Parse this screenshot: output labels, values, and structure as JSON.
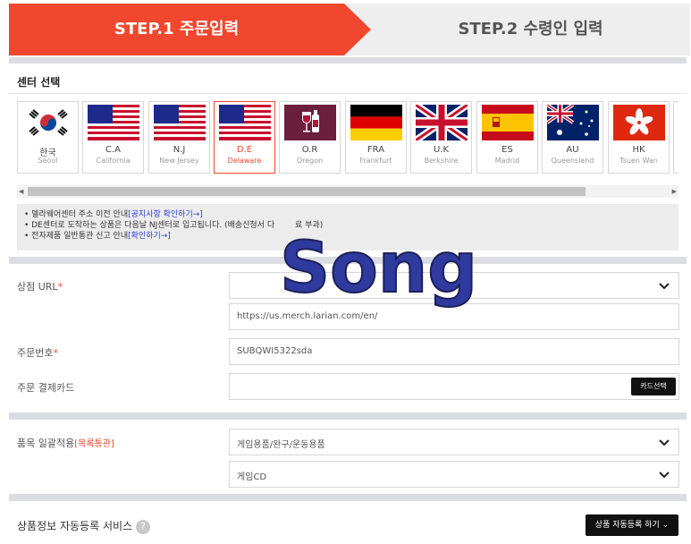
{
  "steps": {
    "step1": "STEP.1 주문입력",
    "step2": "STEP.2 수령인 입력"
  },
  "center_section": {
    "title": "센터 선택",
    "centers": [
      {
        "code": "한국",
        "city": "Seoul",
        "flag": "kr-flag-icon",
        "selected": false
      },
      {
        "code": "C.A",
        "city": "California",
        "flag": "us-flag-icon",
        "selected": false
      },
      {
        "code": "N.J",
        "city": "New Jersey",
        "flag": "us-flag-icon",
        "selected": false
      },
      {
        "code": "D.E",
        "city": "Delaware",
        "flag": "us-flag-icon",
        "selected": true
      },
      {
        "code": "O.R",
        "city": "Oregon",
        "flag": "wine-icon",
        "selected": false
      },
      {
        "code": "FRA",
        "city": "Frankfurt",
        "flag": "de-flag-icon",
        "selected": false
      },
      {
        "code": "U.K",
        "city": "Berkshire",
        "flag": "uk-flag-icon",
        "selected": false
      },
      {
        "code": "ES",
        "city": "Madrid",
        "flag": "es-flag-icon",
        "selected": false
      },
      {
        "code": "AU",
        "city": "Queensland",
        "flag": "au-flag-icon",
        "selected": false
      },
      {
        "code": "HK",
        "city": "Tsuen Wan",
        "flag": "hk-flag-icon",
        "selected": false
      }
    ]
  },
  "notice": {
    "line1_text": "• 델라웨어센터 주소 이전 안내",
    "line1_link": "[공지사항 확인하기→]",
    "line2_text": "• DE센터로 도착하는 상품은 다음날 NJ센터로 입고됩니다. (배송신청서 다",
    "line2_tail": "료 부과)",
    "line3_text": "• 전자제품 일반통관 신고 안내",
    "line3_link": "[확인하기→]"
  },
  "form": {
    "shop_url_label": "상점 URL",
    "required_mark": "*",
    "shop_url_select": "",
    "shop_url_value": "https://us.merch.larian.com/en/",
    "order_no_label": "주문번호",
    "order_no_value": "SUBQWI5322sda",
    "card_label": "주문 결제카드",
    "card_value": "",
    "card_button": "카드선택",
    "category_label": "품목 일괄적용",
    "category_tag": "[목록통관]",
    "category_main": "게임용품/완구/운동용품",
    "category_sub": "게임CD"
  },
  "autoreg": {
    "title": "상품정보 자동등록 서비스",
    "help": "?",
    "button": "상품 자동등록 하기"
  },
  "watermark": {
    "text": "Song"
  },
  "colors": {
    "accent": "#f0472e",
    "band": "#dcdde2",
    "link": "#2f3fd6"
  }
}
